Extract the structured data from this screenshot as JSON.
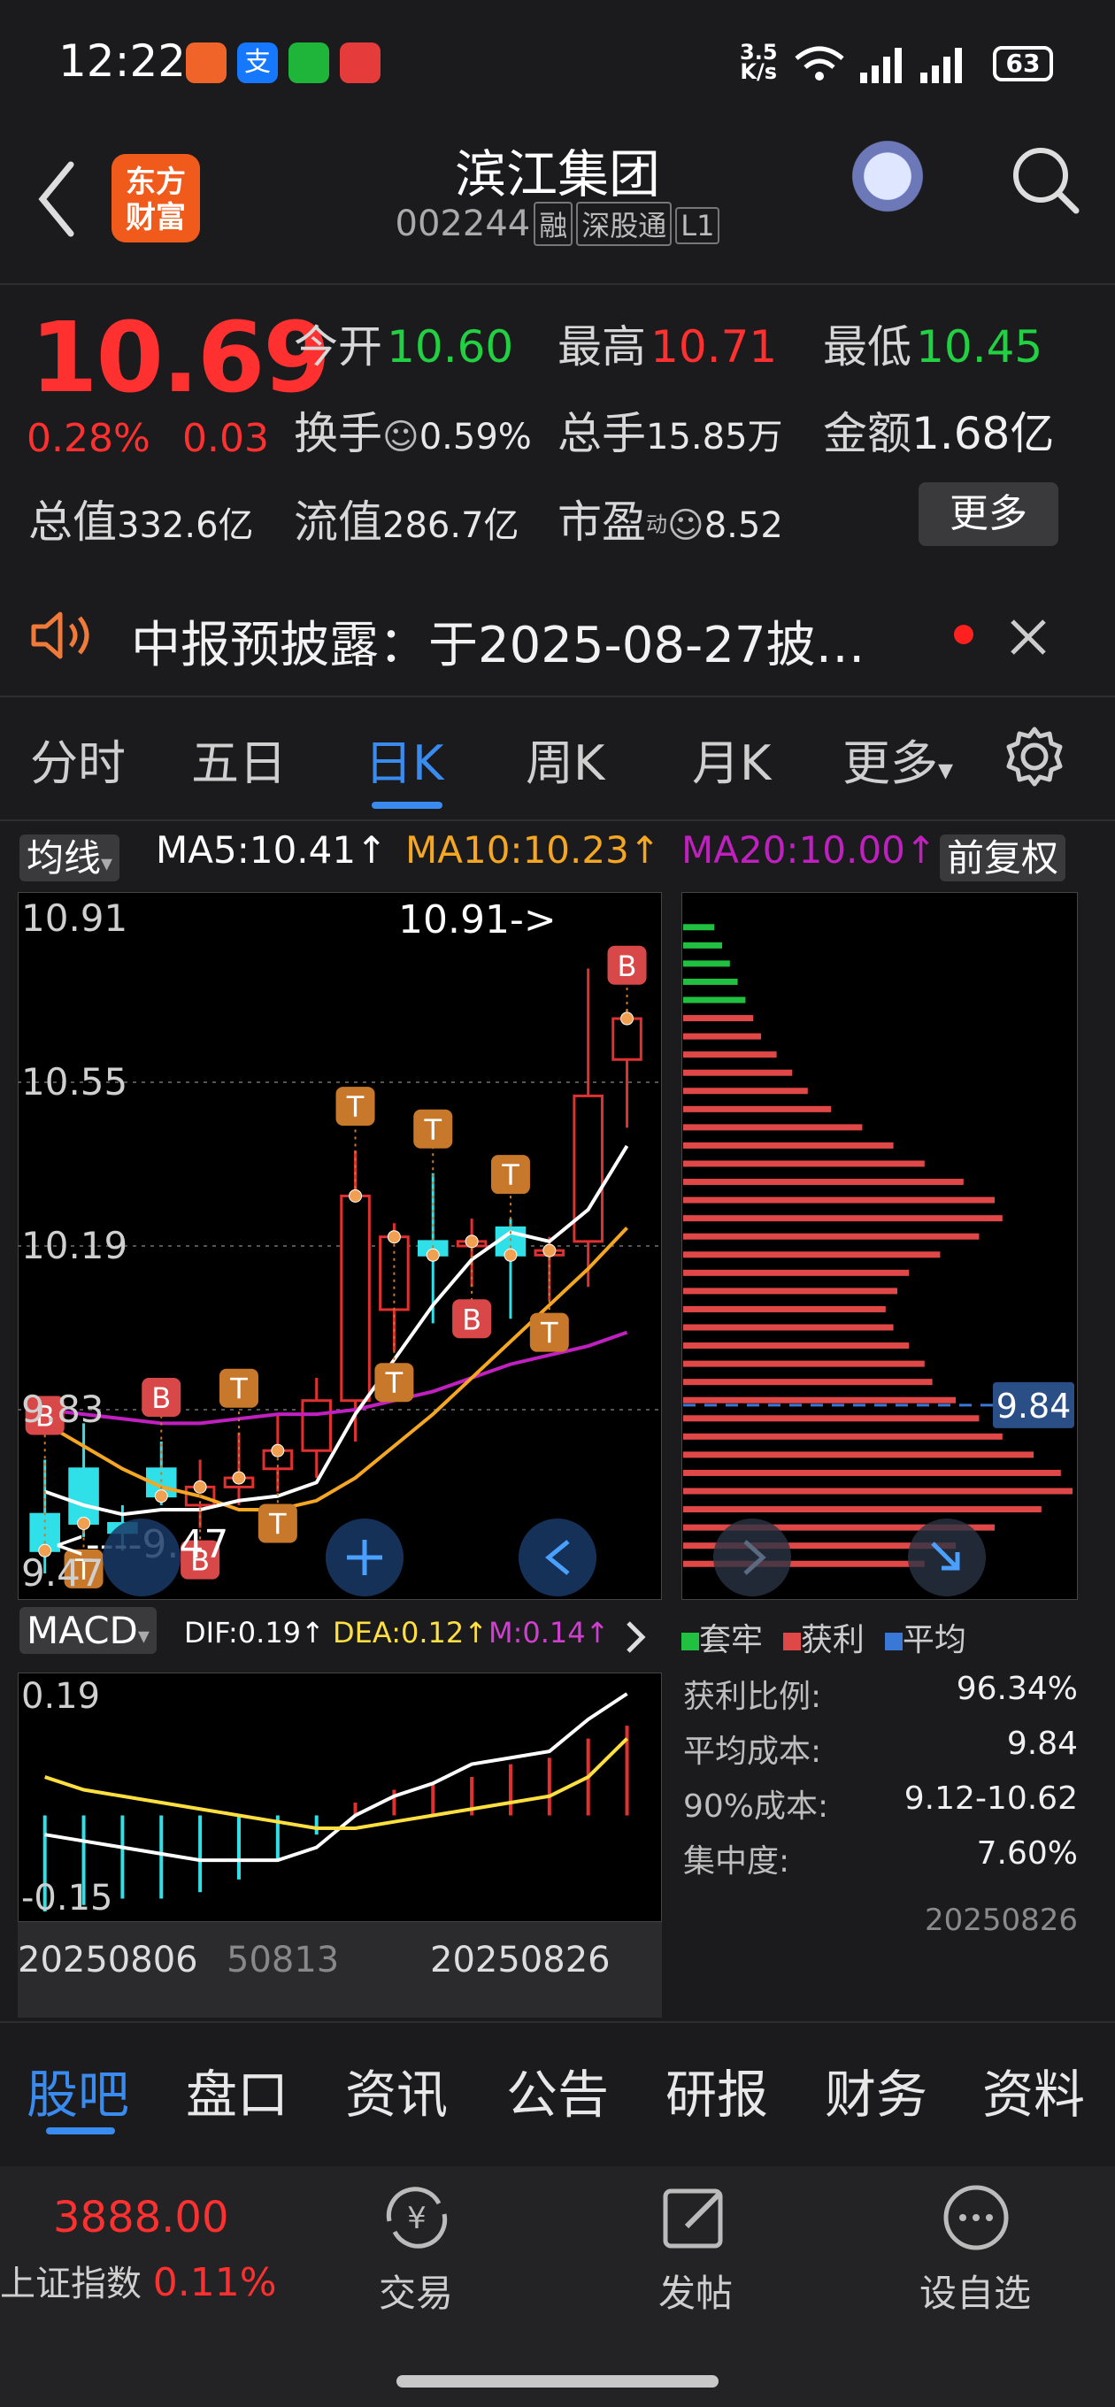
{
  "status_bar": {
    "time": "12:22",
    "net_speed_top": "3.5",
    "net_speed_bottom": "K/s",
    "battery": "63"
  },
  "header": {
    "logo_line1": "东方",
    "logo_line2": "财富",
    "stock_name": "滨江集团",
    "stock_code": "002244",
    "tags": [
      "融",
      "深股通",
      "L1"
    ]
  },
  "quote": {
    "price": "10.69",
    "change_pct": "0.28%",
    "change_abs": "0.03",
    "open_label": "今开",
    "open": "10.60",
    "high_label": "最高",
    "high": "10.71",
    "low_label": "最低",
    "low": "10.45",
    "turnover_label": "换手",
    "turnover": "0.59%",
    "volume_label": "总手",
    "volume": "15.85万",
    "amount_label": "金额",
    "amount": "1.68亿",
    "total_value_label": "总值",
    "total_value": "332.6亿",
    "float_value_label": "流值",
    "float_value": "286.7亿",
    "pe_label": "市盈",
    "pe_sup": "动",
    "pe": "8.52",
    "more_button": "更多"
  },
  "notice": {
    "text": "中报预披露：于2025-08-27披…"
  },
  "chart_tabs": [
    "分时",
    "五日",
    "日K",
    "周K",
    "月K",
    "更多"
  ],
  "active_chart_tab": "日K",
  "ma_bar": {
    "selector": "均线",
    "ma5": "MA5:10.41",
    "ma10": "MA10:10.23",
    "ma20": "MA20:10.00",
    "adjust": "前复权",
    "ma5_color": "#ffffff",
    "ma10_color": "#f5a623",
    "ma20_color": "#c020c0"
  },
  "kline": {
    "y_labels": [
      "10.91",
      "10.55",
      "10.19",
      "9.83",
      "9.47"
    ],
    "high_marker": "10.91->",
    "low_marker": "<----9.47",
    "markers": {
      "buy": "B",
      "take": "T"
    }
  },
  "macd": {
    "selector": "MACD",
    "dif": "DIF:0.19",
    "dea": "DEA:0.12",
    "m": "M:0.14",
    "y_top": "0.19",
    "y_bottom": "-0.15"
  },
  "date_axis": [
    "20250806",
    "50813",
    "20250826"
  ],
  "chip": {
    "legend": [
      "套牢",
      "获利",
      "平均"
    ],
    "legend_colors": [
      "#22c040",
      "#e04848",
      "#3a78d8"
    ],
    "avg_tag": "9.84",
    "stats": [
      {
        "label": "获利比例:",
        "value": "96.34%"
      },
      {
        "label": "平均成本:",
        "value": "9.84"
      },
      {
        "label": "90%成本:",
        "value": "9.12-10.62"
      },
      {
        "label": "集中度:",
        "value": "7.60%"
      }
    ],
    "date": "20250826"
  },
  "bottom_tabs": [
    "股吧",
    "盘口",
    "资讯",
    "公告",
    "研报",
    "财务",
    "资料"
  ],
  "footer": {
    "index_value": "3888.00",
    "index_name": "上证指数",
    "index_change": "0.11%",
    "trade": "交易",
    "trade_symbol": "¥",
    "post": "发帖",
    "watchlist": "设自选"
  },
  "chart_data": [
    {
      "type": "candlestick",
      "title": "",
      "y_ticks": [
        10.91,
        10.55,
        10.19,
        9.83,
        9.47
      ],
      "ylim": [
        9.47,
        10.91
      ],
      "ohlc": [
        [
          9.6,
          9.72,
          9.47,
          9.52
        ],
        [
          9.7,
          9.8,
          9.55,
          9.58
        ],
        [
          9.58,
          9.62,
          9.52,
          9.56
        ],
        [
          9.7,
          9.76,
          9.62,
          9.64
        ],
        [
          9.62,
          9.72,
          9.57,
          9.66
        ],
        [
          9.66,
          9.78,
          9.62,
          9.68
        ],
        [
          9.7,
          9.82,
          9.65,
          9.74
        ],
        [
          9.74,
          9.9,
          9.68,
          9.85
        ],
        [
          9.85,
          10.4,
          9.76,
          10.3
        ],
        [
          10.05,
          10.24,
          9.96,
          10.21
        ],
        [
          10.2,
          10.35,
          10.02,
          10.17
        ],
        [
          10.19,
          10.25,
          10.1,
          10.2
        ],
        [
          10.23,
          10.25,
          10.03,
          10.17
        ],
        [
          10.17,
          10.21,
          10.07,
          10.18
        ],
        [
          10.2,
          10.8,
          10.1,
          10.52
        ],
        [
          10.6,
          10.71,
          10.45,
          10.69
        ]
      ],
      "ma5": [
        9.65,
        9.62,
        9.6,
        9.61,
        9.61,
        9.63,
        9.64,
        9.67,
        9.82,
        9.94,
        10.06,
        10.16,
        10.22,
        10.2,
        10.27,
        10.41
      ],
      "ma10": [
        9.8,
        9.75,
        9.7,
        9.66,
        9.64,
        9.61,
        9.61,
        9.63,
        9.68,
        9.75,
        9.82,
        9.9,
        9.98,
        10.06,
        10.14,
        10.23
      ],
      "ma20": [
        9.83,
        9.82,
        9.81,
        9.8,
        9.8,
        9.81,
        9.82,
        9.82,
        9.83,
        9.85,
        9.87,
        9.9,
        9.93,
        9.95,
        9.97,
        10.0
      ]
    },
    {
      "type": "bar",
      "title": "MACD",
      "ylim": [
        -0.15,
        0.19
      ],
      "values": [
        -0.15,
        -0.14,
        -0.13,
        -0.13,
        -0.12,
        -0.1,
        -0.07,
        -0.03,
        0.02,
        0.04,
        0.05,
        0.06,
        0.08,
        0.09,
        0.12,
        0.14
      ],
      "series": [
        {
          "name": "DIF",
          "values": [
            -0.03,
            -0.04,
            -0.05,
            -0.06,
            -0.07,
            -0.07,
            -0.07,
            -0.05,
            0.0,
            0.03,
            0.05,
            0.08,
            0.09,
            0.1,
            0.15,
            0.19
          ]
        },
        {
          "name": "DEA",
          "values": [
            0.06,
            0.04,
            0.03,
            0.02,
            0.01,
            0.0,
            -0.01,
            -0.02,
            -0.02,
            -0.01,
            0.0,
            0.01,
            0.02,
            0.03,
            0.06,
            0.12
          ]
        }
      ]
    },
    {
      "type": "bar",
      "title": "",
      "orientation": "horizontal",
      "ylim": [
        9.47,
        10.91
      ],
      "prices": [
        10.89,
        10.85,
        10.81,
        10.77,
        10.73,
        10.69,
        10.65,
        10.61,
        10.57,
        10.53,
        10.49,
        10.45,
        10.41,
        10.37,
        10.33,
        10.29,
        10.25,
        10.21,
        10.17,
        10.13,
        10.09,
        10.05,
        10.01,
        9.97,
        9.93,
        9.89,
        9.85,
        9.81,
        9.77,
        9.73,
        9.69,
        9.65,
        9.61,
        9.57,
        9.53,
        9.49
      ],
      "values": [
        0.08,
        0.1,
        0.12,
        0.14,
        0.16,
        0.18,
        0.2,
        0.24,
        0.28,
        0.32,
        0.38,
        0.46,
        0.54,
        0.62,
        0.72,
        0.8,
        0.82,
        0.76,
        0.66,
        0.58,
        0.55,
        0.52,
        0.54,
        0.58,
        0.62,
        0.64,
        0.7,
        0.76,
        0.82,
        0.9,
        0.97,
        1.0,
        0.92,
        0.8,
        0.7,
        0.62
      ],
      "profit_below": 10.71
    }
  ]
}
